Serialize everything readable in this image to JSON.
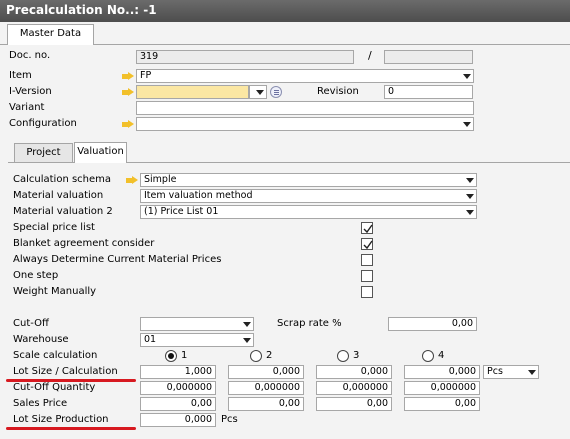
{
  "window": {
    "title": "Precalculation No..: -1"
  },
  "tabs_top": [
    {
      "label": "Master Data"
    }
  ],
  "header": {
    "doc_no_label": "Doc. no.",
    "doc_no_value": "319",
    "slash": "/",
    "item_label": "Item",
    "item_value": "FP",
    "iversion_label": "I-Version",
    "iversion_value": "",
    "revision_label": "Revision",
    "revision_value": "0",
    "variant_label": "Variant",
    "variant_value": "",
    "configuration_label": "Configuration",
    "configuration_value": ""
  },
  "tabs_inner": [
    {
      "label": "Project"
    },
    {
      "label": "Valuation"
    }
  ],
  "valuation": {
    "calc_schema_label": "Calculation schema",
    "calc_schema_value": "Simple",
    "material_valuation_label": "Material valuation",
    "material_valuation_value": "Item valuation method",
    "material_valuation2_label": "Material valuation 2",
    "material_valuation2_value": "(1) Price List 01",
    "checks": [
      {
        "label": "Special price list",
        "checked": true
      },
      {
        "label": "Blanket agreement consider",
        "checked": true
      },
      {
        "label": "Always Determine Current Material Prices",
        "checked": false
      },
      {
        "label": "One step",
        "checked": false
      },
      {
        "label": "Weight Manually",
        "checked": false
      }
    ],
    "cutoff_label": "Cut-Off",
    "cutoff_value": "",
    "scrap_label": "Scrap rate %",
    "scrap_value": "0,00",
    "warehouse_label": "Warehouse",
    "warehouse_value": "01",
    "scale_label": "Scale calculation",
    "scale_options": [
      "1",
      "2",
      "3",
      "4"
    ],
    "scale_selected": "1",
    "lot_size_label": "Lot Size / Calculation",
    "lot_size_values": [
      "1,000",
      "0,000",
      "0,000",
      "0,000"
    ],
    "unit_select": "Pcs",
    "cutoff_qty_label": "Cut-Off Quantity",
    "cutoff_qty_values": [
      "0,000000",
      "0,000000",
      "0,000000",
      "0,000000"
    ],
    "sales_price_label": "Sales Price",
    "sales_price_values": [
      "0,00",
      "0,00",
      "0,00",
      "0,00"
    ],
    "lot_prod_label": "Lot Size Production",
    "lot_prod_value": "0,000",
    "lot_prod_unit": "Pcs"
  },
  "colors": {
    "titlebar": "#555555",
    "highlight": "#fbe7a3",
    "underline": "#d71920",
    "arrow": "#f2c02a"
  }
}
